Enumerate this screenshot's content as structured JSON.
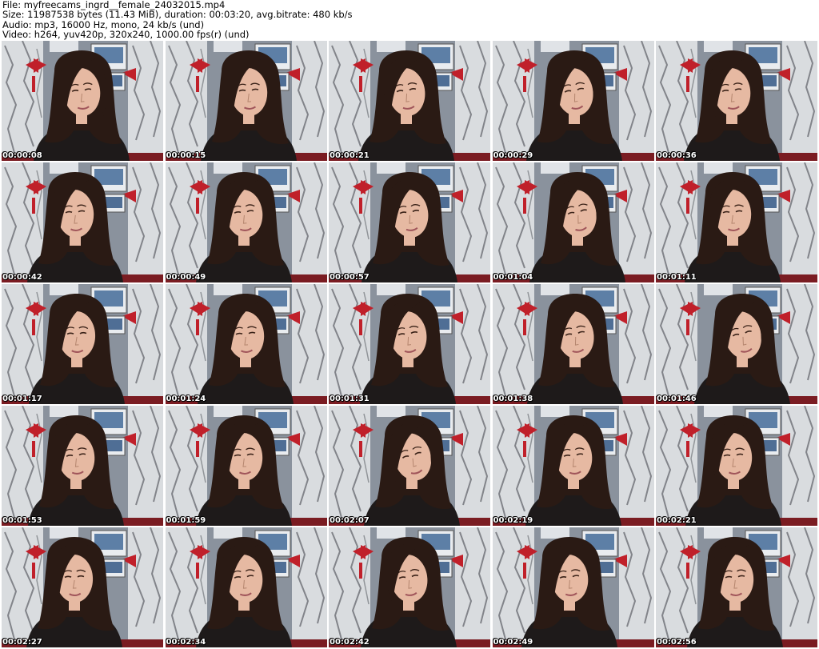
{
  "header": {
    "file_line": "File: myfreecams_ingrd__female_24032015.mp4",
    "size_line": "Size: 11987538 bytes (11.43 MiB), duration: 00:03:20, avg.bitrate: 480 kb/s",
    "audio_line": "Audio: mp3, 16000 Hz, mono, 24 kb/s (und)",
    "video_line": "Video: h264, yuv420p, 320x240, 1000.00 fps(r) (und)"
  },
  "frames": [
    {
      "timestamp": "00:00:08"
    },
    {
      "timestamp": "00:00:15"
    },
    {
      "timestamp": "00:00:21"
    },
    {
      "timestamp": "00:00:29"
    },
    {
      "timestamp": "00:00:36"
    },
    {
      "timestamp": "00:00:42"
    },
    {
      "timestamp": "00:00:49"
    },
    {
      "timestamp": "00:00:57"
    },
    {
      "timestamp": "00:01:04"
    },
    {
      "timestamp": "00:01:11"
    },
    {
      "timestamp": "00:01:17"
    },
    {
      "timestamp": "00:01:24"
    },
    {
      "timestamp": "00:01:31"
    },
    {
      "timestamp": "00:01:38"
    },
    {
      "timestamp": "00:01:46"
    },
    {
      "timestamp": "00:01:53"
    },
    {
      "timestamp": "00:01:59"
    },
    {
      "timestamp": "00:02:07"
    },
    {
      "timestamp": "00:02:19"
    },
    {
      "timestamp": "00:02:21"
    },
    {
      "timestamp": "00:02:27"
    },
    {
      "timestamp": "00:02:34"
    },
    {
      "timestamp": "00:02:42"
    },
    {
      "timestamp": "00:02:49"
    },
    {
      "timestamp": "00:02:56"
    }
  ],
  "colors": {
    "wall": "#8a929d",
    "curtain": "#d9dcdf",
    "ribbon": "#c0202a",
    "hair": "#2a1a14",
    "skin": "#e6b9a2",
    "shirt": "#1e1a1a",
    "desk": "#7a1c22"
  }
}
